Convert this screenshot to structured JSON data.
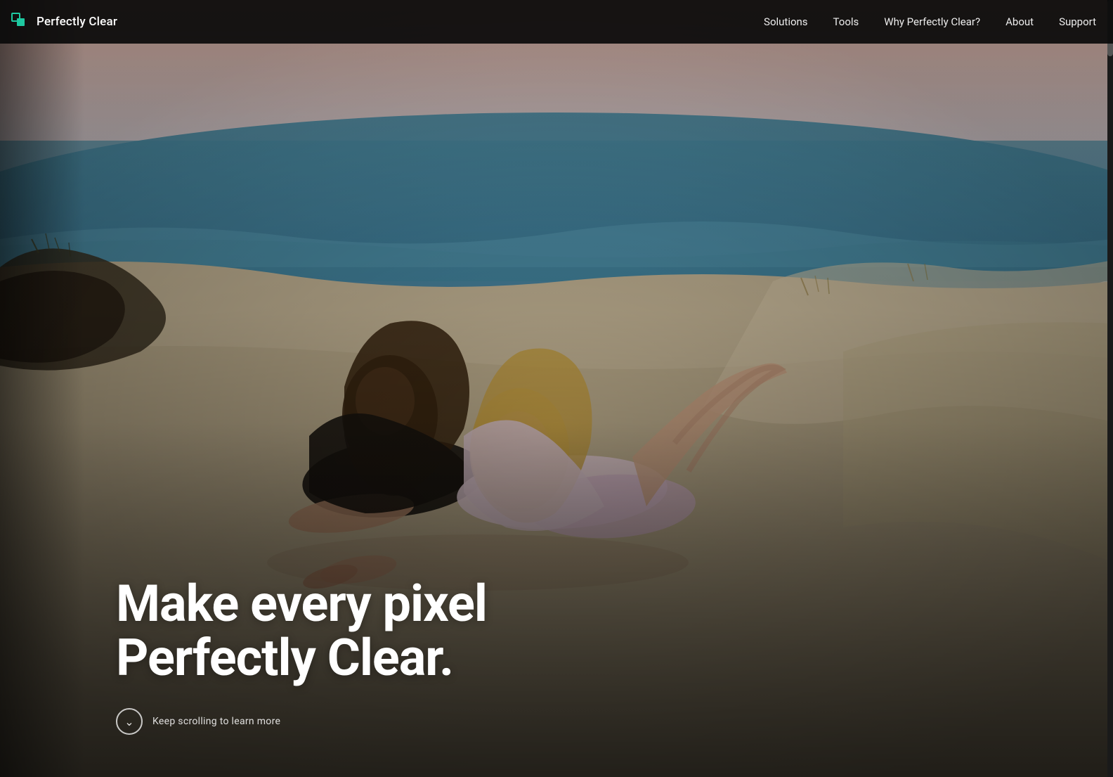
{
  "brand": {
    "logo_text": "Perfectly Clear",
    "logo_icon_alt": "Perfectly Clear logo"
  },
  "nav": {
    "links": [
      {
        "id": "solutions",
        "label": "Solutions"
      },
      {
        "id": "tools",
        "label": "Tools"
      },
      {
        "id": "why",
        "label": "Why Perfectly Clear?"
      },
      {
        "id": "about",
        "label": "About"
      },
      {
        "id": "support",
        "label": "Support"
      }
    ]
  },
  "hero": {
    "headline_line1": "Make every pixel",
    "headline_line2": "Perfectly Clear.",
    "scroll_text": "Keep scrolling to learn more"
  }
}
